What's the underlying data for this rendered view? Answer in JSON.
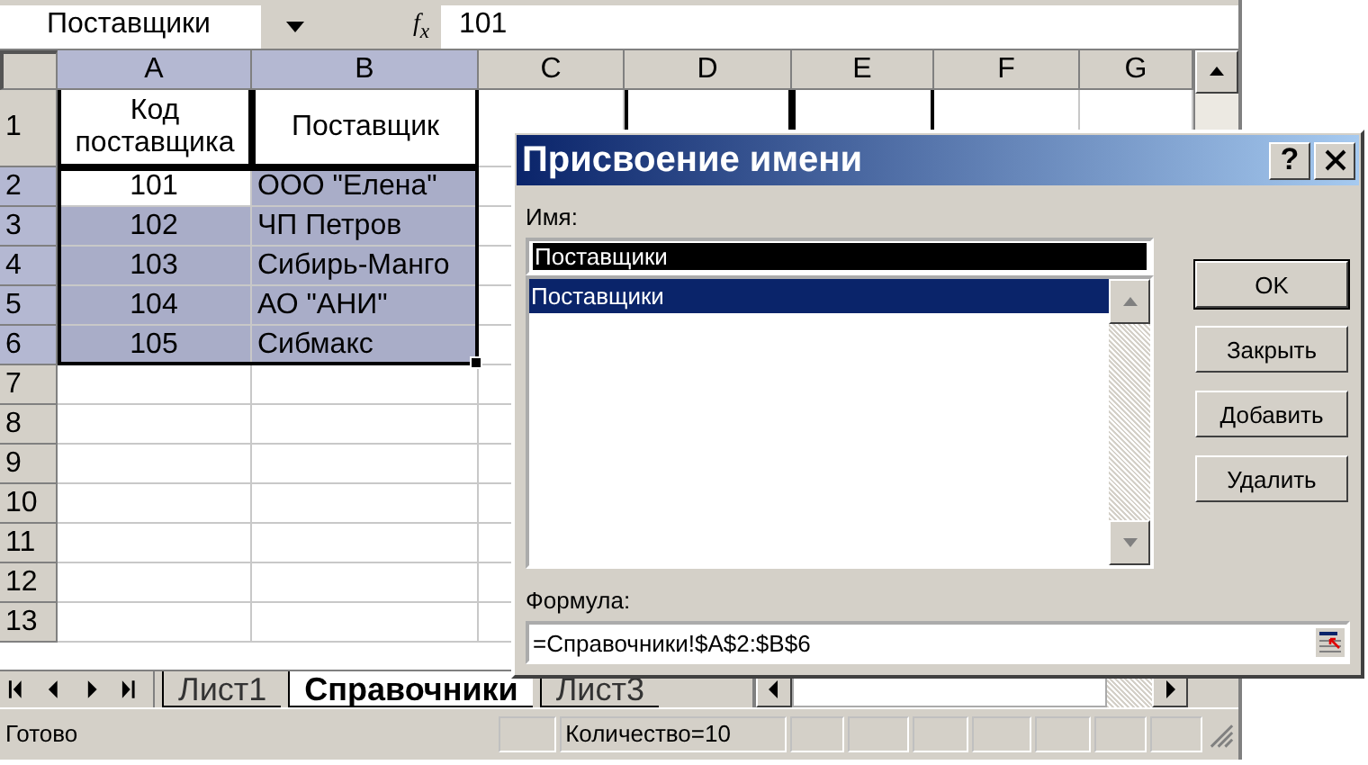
{
  "formula_bar": {
    "name_box": "Поставщики",
    "function_label": "f$_{x}$",
    "value": "101"
  },
  "columns": [
    {
      "label": "A",
      "selected": true
    },
    {
      "label": "B",
      "selected": true
    },
    {
      "label": "C",
      "selected": false
    },
    {
      "label": "D",
      "selected": false
    },
    {
      "label": "E",
      "selected": false
    },
    {
      "label": "F",
      "selected": false
    },
    {
      "label": "G",
      "selected": false
    }
  ],
  "rows": [
    {
      "number": "1",
      "selected": false,
      "cells": [
        {
          "text": "Код поставщика",
          "boxed": true
        },
        {
          "text": "Поставщик",
          "boxed": true
        },
        null,
        {
          "boxed": true
        },
        {
          "boxed": true
        },
        null,
        null
      ]
    },
    {
      "number": "2",
      "selected": true,
      "cells": [
        {
          "text": "101",
          "selected": true,
          "active": true
        },
        {
          "text": "ООО \"Елена\"",
          "selected": true,
          "active": false
        }
      ]
    },
    {
      "number": "3",
      "selected": true,
      "cells": [
        {
          "text": "102",
          "selected": true,
          "active": false
        },
        {
          "text": "ЧП Петров",
          "selected": true,
          "active": false
        }
      ]
    },
    {
      "number": "4",
      "selected": true,
      "cells": [
        {
          "text": "103",
          "selected": true,
          "active": false
        },
        {
          "text": "Сибирь-Манго",
          "selected": true,
          "active": false
        }
      ]
    },
    {
      "number": "5",
      "selected": true,
      "cells": [
        {
          "text": "104",
          "selected": true,
          "active": false
        },
        {
          "text": "АО \"АНИ\"",
          "selected": true,
          "active": false
        }
      ]
    },
    {
      "number": "6",
      "selected": true,
      "cells": [
        {
          "text": "105",
          "selected": true,
          "active": false
        },
        {
          "text": "Сибмакс",
          "selected": true,
          "active": false
        }
      ]
    },
    {
      "number": "7",
      "selected": false
    },
    {
      "number": "8",
      "selected": false
    },
    {
      "number": "9",
      "selected": false
    },
    {
      "number": "10",
      "selected": false
    },
    {
      "number": "11",
      "selected": false
    },
    {
      "number": "12",
      "selected": false
    },
    {
      "number": "13",
      "selected": false
    }
  ],
  "sheet_tabs": [
    {
      "label": "Лист1",
      "selected": false
    },
    {
      "label": "Справочники",
      "selected": true
    },
    {
      "label": "Лист3",
      "selected": false
    }
  ],
  "status_bar": {
    "state": "Готово",
    "summary": "Количество=10"
  },
  "dialog": {
    "title": "Присвоение имени",
    "help": "?",
    "name_label": "Имя:",
    "name_value": "Поставщики",
    "names_list": [
      {
        "text": "Поставщики",
        "selected": true
      }
    ],
    "buttons": [
      {
        "label": "OK",
        "default": true
      },
      {
        "label": "Закрыть",
        "default": false
      },
      {
        "label": "Добавить",
        "default": false
      },
      {
        "label": "Удалить",
        "default": false
      }
    ],
    "formula_label": "Формула:",
    "formula_value": "=Справочники!$A$2:$B$6"
  }
}
